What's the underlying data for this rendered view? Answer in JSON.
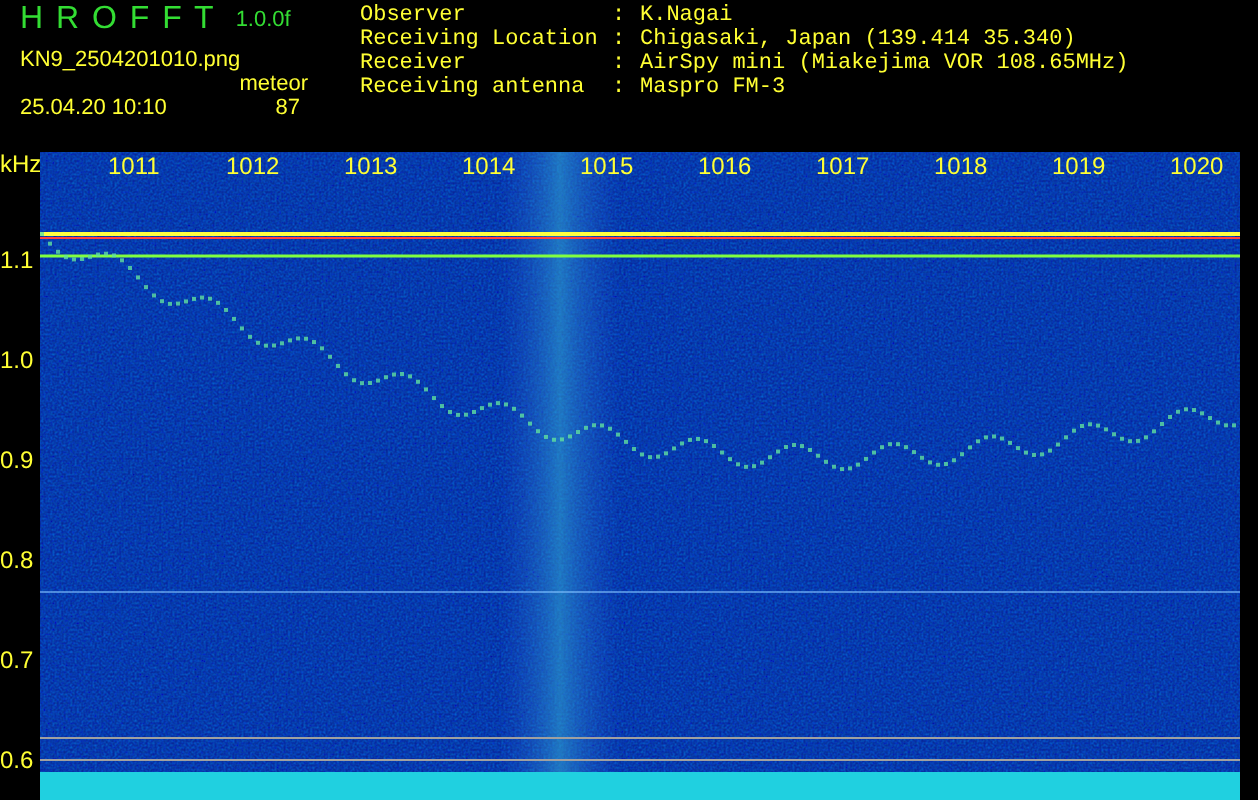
{
  "header": {
    "title": "H R O F F T",
    "version": "1.0.0f",
    "filename": "KN9_2504201010.png",
    "timestamp": "25.04.20 10:10",
    "meteor_label": "meteor",
    "meteor_count": "87"
  },
  "info": [
    {
      "label": "Observer",
      "separator": ":",
      "value": "K.Nagai"
    },
    {
      "label": "Receiving Location",
      "separator": ":",
      "value": "Chigasaki, Japan (139.414 35.340)"
    },
    {
      "label": "Receiver",
      "separator": ":",
      "value": "AirSpy mini (Miakejima VOR 108.65MHz)"
    },
    {
      "label": "Receiving antenna",
      "separator": ":",
      "value": "Maspro FM-3"
    }
  ],
  "plot": {
    "y_unit": "kHz",
    "x_ticks": [
      "1011",
      "1012",
      "1013",
      "1014",
      "1015",
      "1016",
      "1017",
      "1018",
      "1019",
      "1020"
    ],
    "y_ticks": [
      "1.1",
      "1.0",
      "0.9",
      "0.8",
      "0.7",
      "0.6"
    ]
  }
}
